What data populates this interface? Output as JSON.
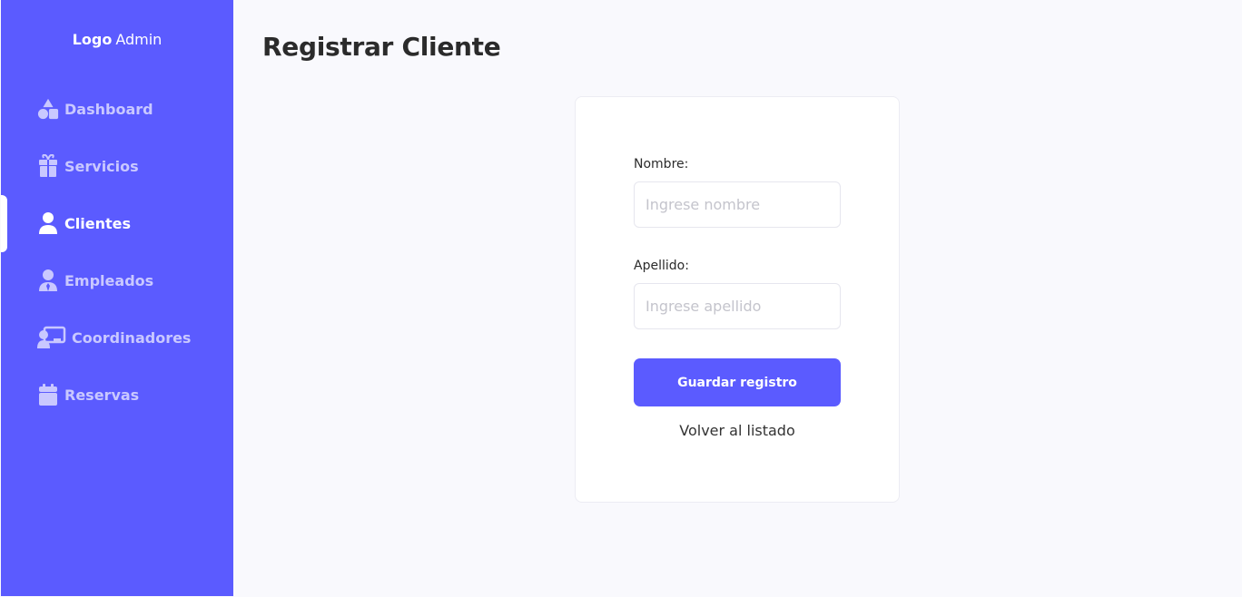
{
  "sidebar": {
    "logo_strong": "Logo",
    "logo_light": "Admin",
    "accent_color": "#5b5bff",
    "items": [
      {
        "label": "Dashboard",
        "icon": "shapes-icon",
        "active": false
      },
      {
        "label": "Servicios",
        "icon": "gift-icon",
        "active": false
      },
      {
        "label": "Clientes",
        "icon": "user-icon",
        "active": true
      },
      {
        "label": "Empleados",
        "icon": "user-tie-icon",
        "active": false
      },
      {
        "label": "Coordinadores",
        "icon": "chalkboard-teacher-icon",
        "active": false
      },
      {
        "label": "Reservas",
        "icon": "calendar-icon",
        "active": false
      }
    ]
  },
  "main": {
    "title": "Registrar Cliente",
    "form": {
      "nombre_label": "Nombre:",
      "nombre_placeholder": "Ingrese nombre",
      "nombre_value": "",
      "apellido_label": "Apellido:",
      "apellido_placeholder": "Ingrese apellido",
      "apellido_value": "",
      "submit_label": "Guardar registro",
      "back_label": "Volver al listado"
    }
  }
}
